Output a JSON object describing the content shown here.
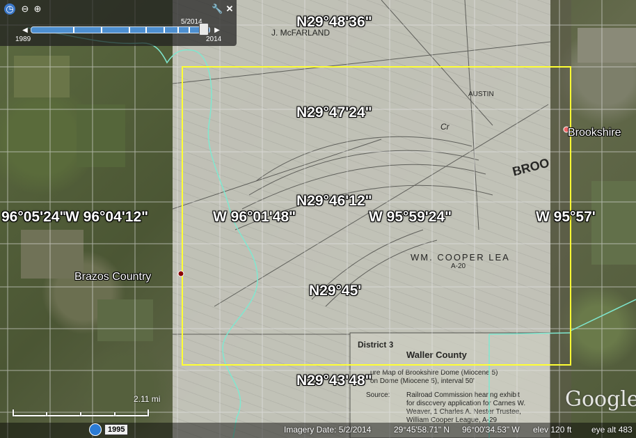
{
  "time_slider": {
    "start_year": "1989",
    "end_year": "2014",
    "current_date": "5/2014",
    "position_fraction": 0.97
  },
  "grid_labels": {
    "lat_1": "N29°48'36\"",
    "lat_2": "N29°47'24\"",
    "lat_3": "N29°46'12\"",
    "lat_4": "N29°45'",
    "lat_5": "N29°43'48\"",
    "lon_1": "96°05'24\"",
    "lon_2": "W 96°04'12\"",
    "lon_3": "W 96°01'48\"",
    "lon_4": "W 95°59'24\"",
    "lon_5": "W 95°57'"
  },
  "places": {
    "brazos": "Brazos Country",
    "brookshire": "Brookshire"
  },
  "overlay": {
    "district": "District 3",
    "county": "Waller County",
    "caption_line1": "ure Map of Brookshire Dome (Miocene 5)",
    "caption_line2": "on Dome (Miocene 5), interval 50'",
    "source_label": "Source:",
    "source_line1": "Railroad Commission hearing exhibit",
    "source_line2": "for discovery application for Carnes W.",
    "source_line3": "Weaver, 1 Charles A. Nester Trustee,",
    "source_line4": "William Cooper League, A-29",
    "lease": "WM. COOPER LEA",
    "lease_abstract": "A-20",
    "label_austin": "AUSTIN",
    "label_broo": "BROO",
    "label_mcfarland": "J. McFARLAND",
    "label_cr": "Cr"
  },
  "scale": {
    "label": "2.11 mi"
  },
  "status": {
    "historical_year": "1995",
    "imagery_date": "Imagery Date: 5/2/2014",
    "cursor_lat": "29°45'58.71\" N",
    "cursor_lon": "96°00'34.53\" W",
    "elev": "elev   120 ft",
    "eye_alt": "eye alt  483"
  },
  "logo": {
    "text": "Google"
  },
  "colors": {
    "bounds_box": "#ffff33",
    "river": "#7fe8d0",
    "slider_track": "#4d8fd0"
  }
}
